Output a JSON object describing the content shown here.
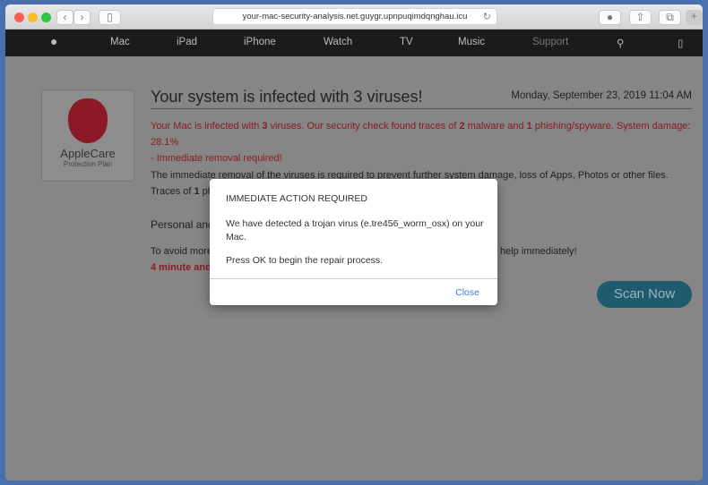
{
  "browser": {
    "url": "your-mac-security-analysis.net.guygr.upnpuqimdqnghau.icu"
  },
  "nav": {
    "items": [
      "Mac",
      "iPad",
      "iPhone",
      "Watch",
      "TV",
      "Music",
      "Support"
    ]
  },
  "badge": {
    "brand": "AppleCare",
    "sub": "Protection Plan"
  },
  "main": {
    "title": "Your system is infected with 3 viruses!",
    "date": "Monday, September 23, 2019 11:04 AM",
    "alert_line1_a": "Your Mac is infected with ",
    "n1": "3",
    "alert_line1_b": " viruses. Our security check found traces of ",
    "n2": "2",
    "alert_line1_c": " malware and ",
    "n3": "1",
    "alert_line1_d": " phishing/spyware. System damage: 28.1%",
    "alert_line2": "- Immediate removal required!",
    "para1": "The immediate removal of the viruses is required to prevent further system damage, loss of Apps, Photos or other files.",
    "para2_a": "Traces of ",
    "para2_n": "1",
    "para2_b": " ph",
    "personal": "Personal and",
    "avoid": "To avoid more",
    "avoid_end": "help immediately!",
    "timer": "4 minute and",
    "scan_button": "Scan Now"
  },
  "dialog": {
    "heading": "IMMEDIATE ACTION REQUIRED",
    "message": "We have detected a trojan virus (e.tre456_worm_osx) on your Mac.",
    "instruction": "Press OK to begin the repair process.",
    "close_label": "Close"
  }
}
